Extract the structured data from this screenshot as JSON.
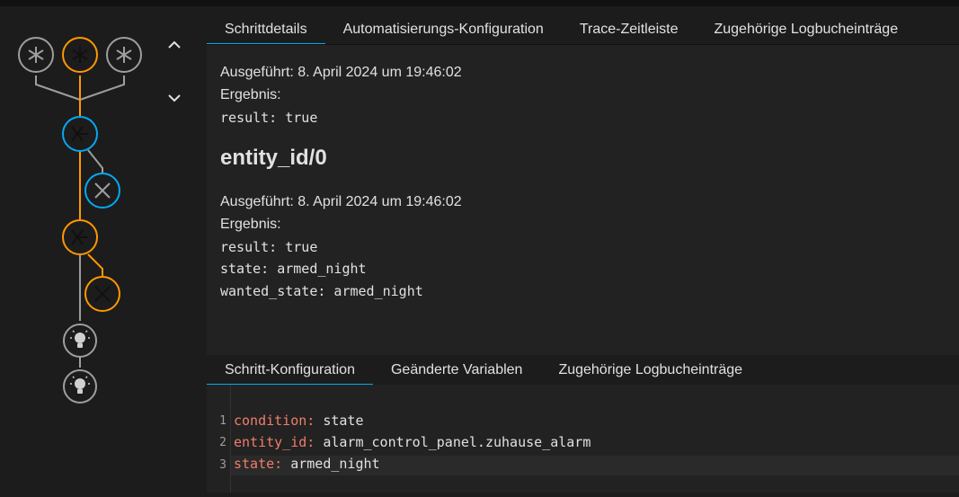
{
  "top_tabs": [
    {
      "label": "Schrittdetails",
      "active": true
    },
    {
      "label": "Automatisierungs-Konfiguration",
      "active": false
    },
    {
      "label": "Trace-Zeitleiste",
      "active": false
    },
    {
      "label": "Zugehörige Logbucheinträge",
      "active": false
    }
  ],
  "details": {
    "block1": {
      "executed": "Ausgeführt: 8. April 2024 um 19:46:02",
      "result_label": "Ergebnis:",
      "result_line": "result: true"
    },
    "heading": "entity_id/0",
    "block2": {
      "executed": "Ausgeführt: 8. April 2024 um 19:46:02",
      "result_label": "Ergebnis:",
      "lines": [
        "result: true",
        "state: armed_night",
        "wanted_state: armed_night"
      ]
    }
  },
  "bottom_tabs": [
    {
      "label": "Schritt-Konfiguration",
      "active": true
    },
    {
      "label": "Geänderte Variablen",
      "active": false
    },
    {
      "label": "Zugehörige Logbucheinträge",
      "active": false
    }
  ],
  "code": [
    {
      "num": "1",
      "key": "condition",
      "value": " state"
    },
    {
      "num": "2",
      "key": "entity_id",
      "value": " alarm_control_panel.zuhause_alarm"
    },
    {
      "num": "3",
      "key": "state",
      "value": " armed_night"
    }
  ],
  "colors": {
    "accent": "#03a9f4",
    "active_path": "#ff9800",
    "inactive_path": "#9e9e9e",
    "yaml_key": "#f07d6c"
  },
  "icons": {
    "trigger": "asterisk-icon",
    "condition": "condition-icon",
    "fail": "close-icon",
    "action": "lightbulb-icon",
    "nav_up": "chevron-up-icon",
    "nav_down": "chevron-down-icon"
  }
}
